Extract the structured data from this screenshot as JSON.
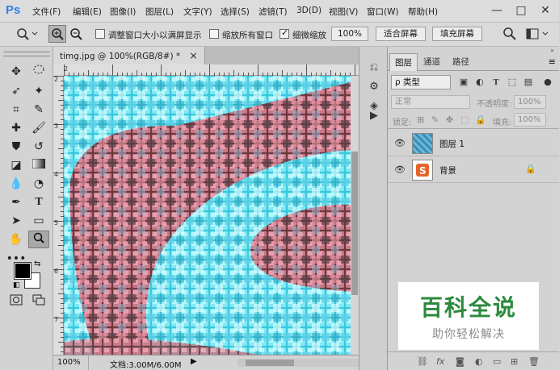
{
  "menubar": {
    "logo": "Ps",
    "items": [
      "文件(F)",
      "编辑(E)",
      "图像(I)",
      "图层(L)",
      "文字(Y)",
      "选择(S)",
      "滤镜(T)",
      "3D(D)",
      "视图(V)",
      "窗口(W)",
      "帮助(H)"
    ],
    "window_controls": [
      "—",
      "□",
      "✕"
    ]
  },
  "options": {
    "resize_windows_label": "调整窗口大小以满屏显示",
    "resize_windows_checked": false,
    "zoom_all_label": "缩放所有窗口",
    "zoom_all_checked": false,
    "scrubby_label": "细微缩放",
    "scrubby_checked": true,
    "percent_button": "100%",
    "fit_screen_button": "适合屏幕",
    "fill_screen_button": "填充屏幕"
  },
  "document": {
    "tab_title": "timg.jpg @ 100%(RGB/8#) *",
    "close_glyph": "×",
    "ruler_top_label": "2",
    "ruler_left_labels": [
      "2",
      "3",
      "4",
      "5",
      "6",
      "7"
    ],
    "status_zoom": "100%",
    "status_doc": "文档:3.00M/6.00M"
  },
  "layers_panel": {
    "tabs": [
      "图层",
      "通道",
      "路径"
    ],
    "active_tab": "图层",
    "filter_label": "ρ 类型",
    "blend_mode": "正常",
    "opacity_label": "不透明度:",
    "opacity_value": "100%",
    "lock_label": "锁定:",
    "fill_label": "填充:",
    "fill_value": "100%",
    "layers": [
      {
        "name": "图层 1",
        "visible": true,
        "locked": false
      },
      {
        "name": "背景",
        "visible": true,
        "locked": true
      }
    ]
  },
  "watermark": {
    "title": "百科全说",
    "subtitle": "助你轻松解决"
  },
  "colors": {
    "accent_blue": "#2f7fe6",
    "mosaic_cyan": "#6fe4f0",
    "mosaic_pink": "#d07888",
    "watermark_green": "#2b8a3e"
  }
}
